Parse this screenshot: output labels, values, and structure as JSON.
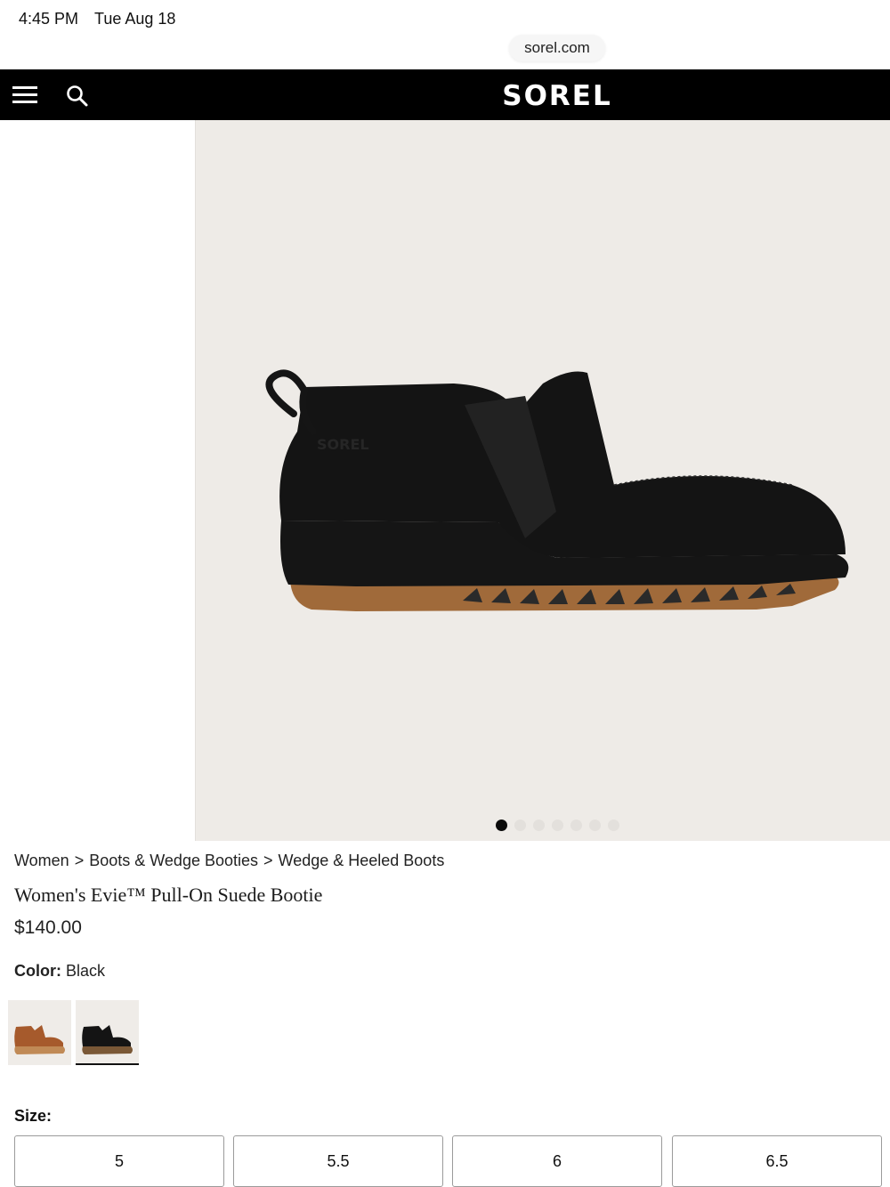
{
  "status_bar": {
    "time": "4:45 PM",
    "date": "Tue Aug 18",
    "url": "sorel.com"
  },
  "header": {
    "logo": "SOREL",
    "icons": [
      "menu-icon",
      "search-icon"
    ]
  },
  "product_image": {
    "slide_count": 7,
    "active_slide": 1
  },
  "breadcrumb": [
    "Women",
    ">",
    "Boots & Wedge Booties",
    ">",
    "Wedge & Heeled Boots"
  ],
  "product": {
    "title": "Women's Evie™ Pull-On Suede Bootie",
    "price": "$140.00",
    "color_label": "Color:",
    "color_value": "Black",
    "swatches": [
      "brown",
      "black"
    ],
    "size_label": "Size:",
    "sizes": [
      "5",
      "5.5",
      "6",
      "6.5"
    ]
  },
  "colors": {
    "nav_background": "#000000",
    "image_background": "#eeebe7",
    "accent": "#111111"
  }
}
